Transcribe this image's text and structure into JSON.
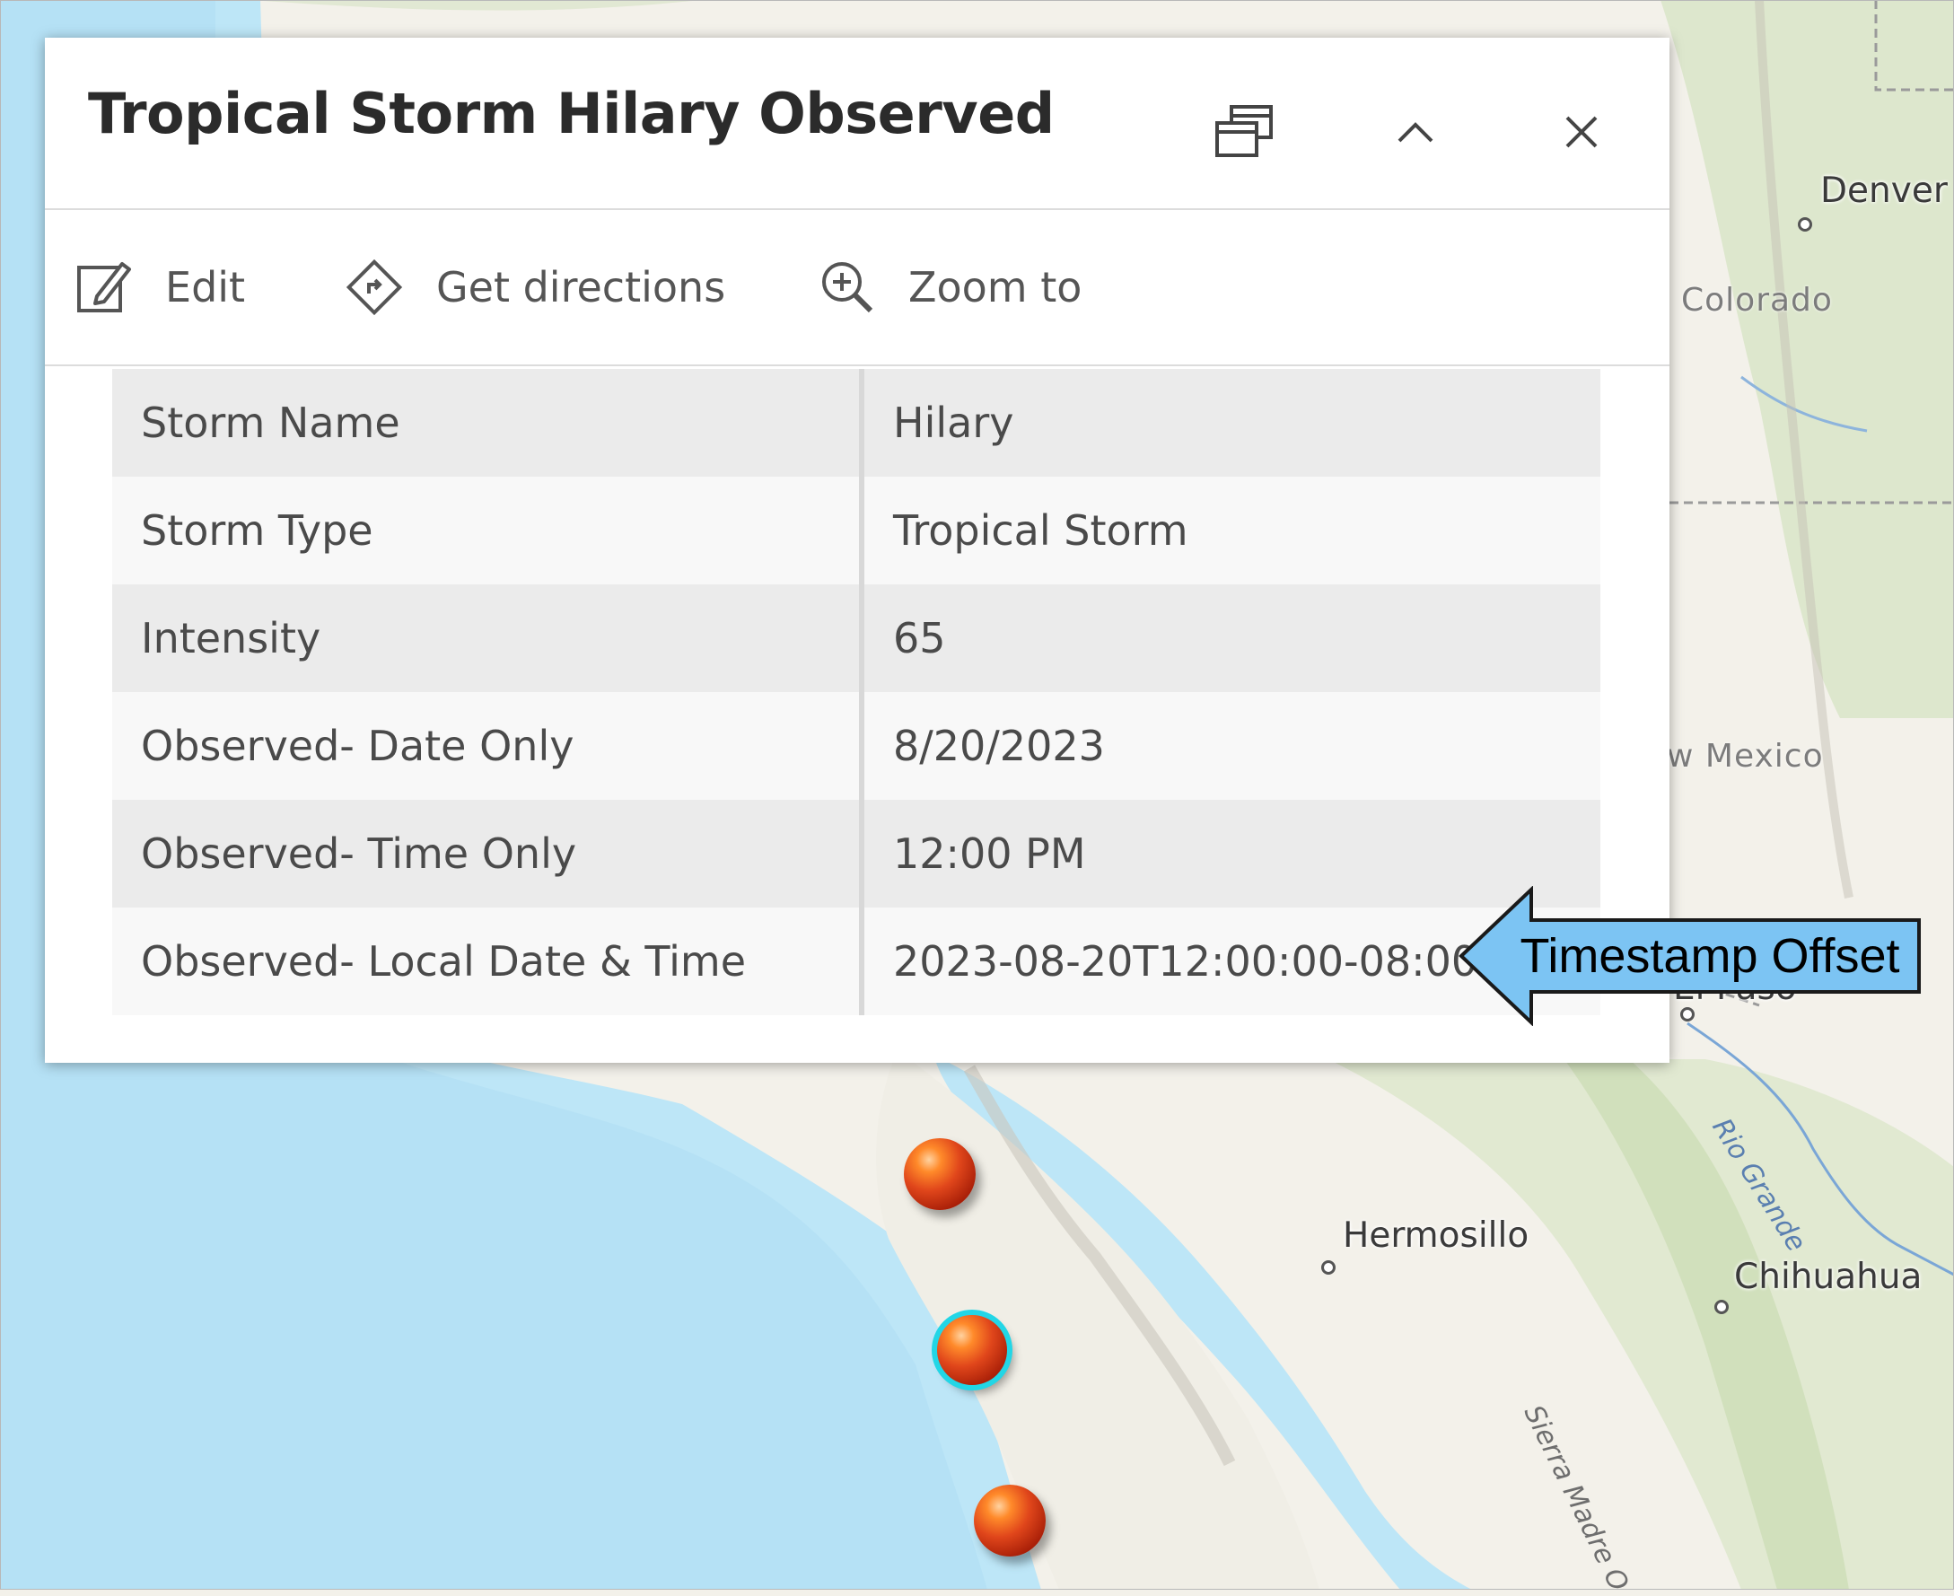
{
  "map": {
    "cities": [
      "Denver",
      "Hermosillo",
      "Chihuahua",
      "El Paso"
    ],
    "states": [
      "Colorado",
      "w Mexico"
    ],
    "river": "Rio Grande",
    "range": "Sierra Madre O",
    "markers": [
      "storm-point",
      "storm-point-selected",
      "storm-point"
    ],
    "colors": {
      "water": "#bde6f7",
      "land": "#f3f1ea",
      "vegetation": "#d6e3c3",
      "marker": "#e0461b",
      "highlight": "#22d6e6"
    }
  },
  "popup": {
    "title": "Tropical Storm Hilary Observed",
    "header_icons": [
      "dock-icon",
      "collapse-chevron-icon",
      "close-icon"
    ],
    "actions": [
      {
        "label": "Edit",
        "icon": "edit-icon"
      },
      {
        "label": "Get directions",
        "icon": "directions-icon"
      },
      {
        "label": "Zoom to",
        "icon": "zoom-in-icon"
      }
    ],
    "attributes": [
      {
        "field": "Storm Name",
        "value": "Hilary"
      },
      {
        "field": "Storm Type",
        "value": "Tropical Storm"
      },
      {
        "field": "Intensity",
        "value": "65"
      },
      {
        "field": "Observed- Date Only",
        "value": "8/20/2023"
      },
      {
        "field": "Observed- Time Only",
        "value": "12:00 PM"
      },
      {
        "field": "Observed- Local Date & Time",
        "value": "2023-08-20T12:00:00-08:00"
      }
    ]
  },
  "callout": {
    "text": "Timestamp Offset",
    "color": "#7cc4f3"
  }
}
